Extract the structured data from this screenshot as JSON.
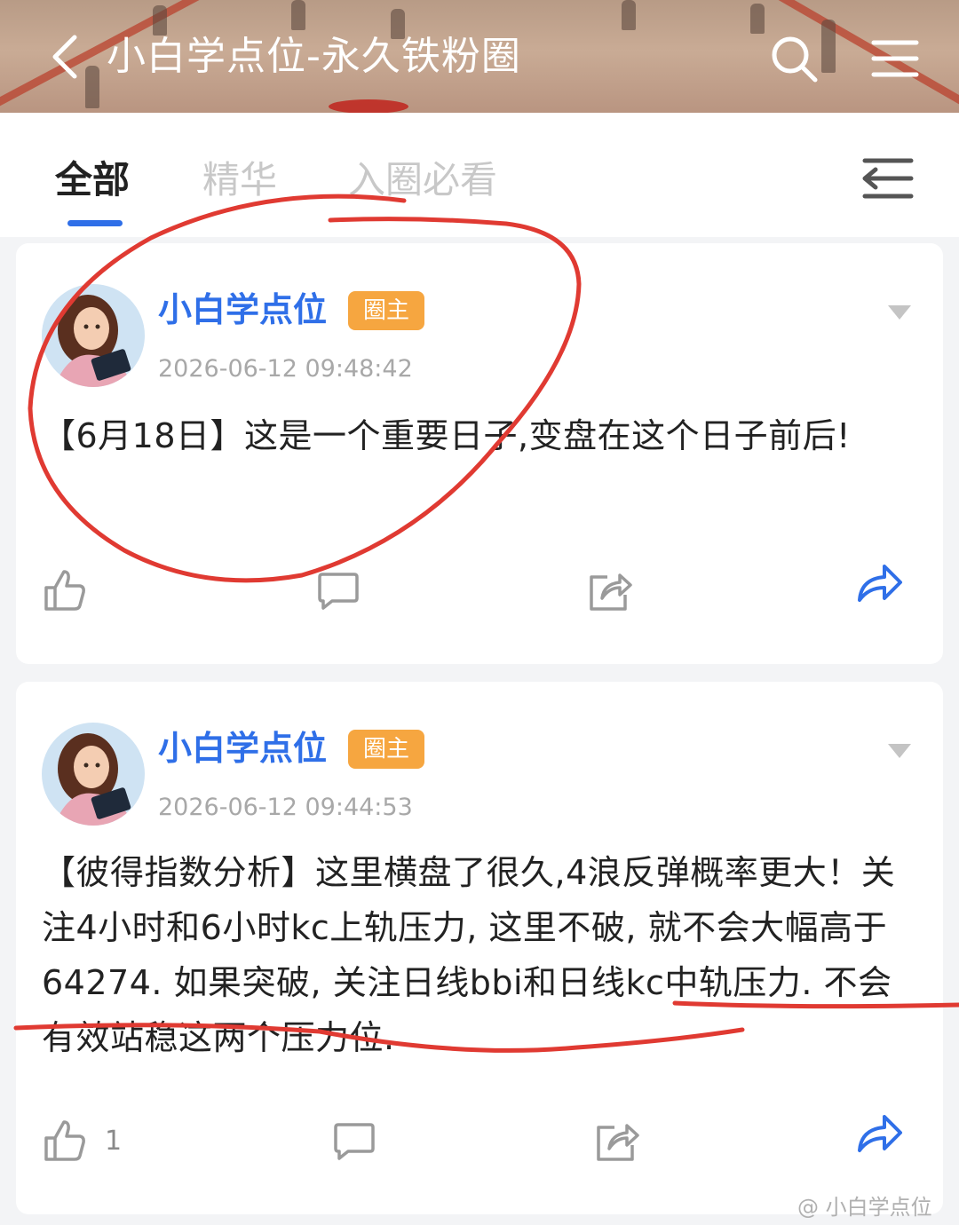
{
  "header": {
    "title": "小白学点位-永久铁粉圈",
    "icons": [
      "back-arrow-icon",
      "search-icon",
      "menu-icon"
    ]
  },
  "tabs": [
    {
      "label": "全部",
      "active": true
    },
    {
      "label": "精华",
      "active": false
    },
    {
      "label": "入圈必看",
      "active": false
    }
  ],
  "colors": {
    "accent": "#2f6fe8",
    "badge": "#f6a640",
    "annotation": "#e03a32"
  },
  "posts": [
    {
      "author": "小白学点位",
      "badge": "圈主",
      "time": "2026-06-12 09:48:42",
      "content": "【6月18日】这是一个重要日子,变盘在这个日子前后!",
      "likes": ""
    },
    {
      "author": "小白学点位",
      "badge": "圈主",
      "time": "2026-06-12 09:44:53",
      "content": "【彼得指数分析】这里横盘了很久,4浪反弹概率更大！关注4小时和6小时kc上轨压力, 这里不破, 就不会大幅高于 64274. 如果突破, 关注日线bbi和日线kc中轨压力. 不会有效站稳这两个压力位.",
      "likes": "1"
    }
  ],
  "watermark": "@ 小白学点位"
}
